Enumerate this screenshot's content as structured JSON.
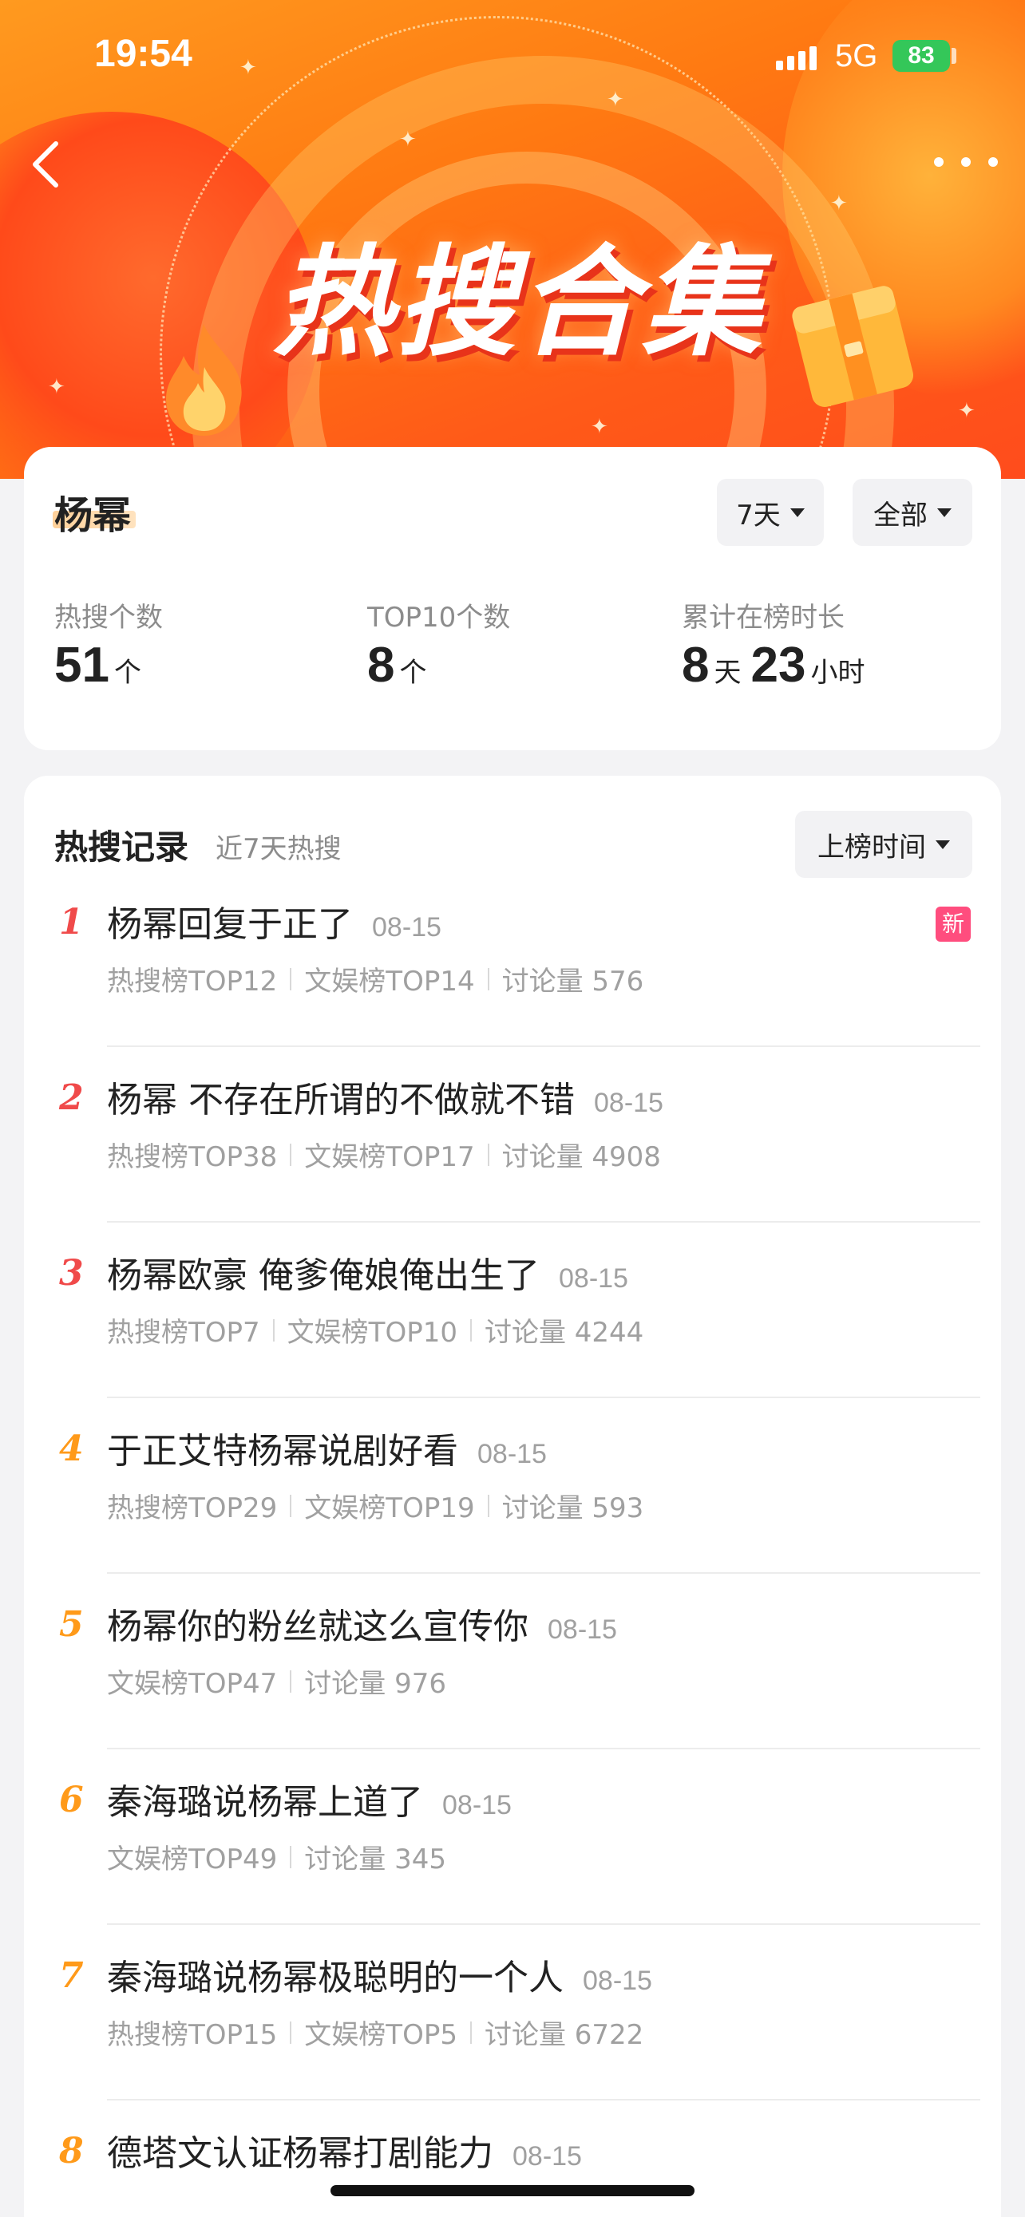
{
  "status": {
    "time": "19:54",
    "network": "5G",
    "battery": "83"
  },
  "header": {
    "title": "热搜合集"
  },
  "person": {
    "name": "杨幂",
    "filters": {
      "period": "7天",
      "scope": "全部"
    }
  },
  "stats": [
    {
      "label": "热搜个数",
      "value": "51",
      "unit": "个"
    },
    {
      "label": "TOP10个数",
      "value": "8",
      "unit": "个"
    },
    {
      "label": "累计在榜时长",
      "value": "8",
      "unit": "天",
      "value2": "23",
      "unit2": "小时"
    }
  ],
  "records_section": {
    "title": "热搜记录",
    "subtitle": "近7天热搜",
    "sort_label": "上榜时间",
    "new_badge": "新",
    "items": [
      {
        "rank": "1",
        "rank_color": "#f04a4a",
        "title": "杨幂回复于正了",
        "date": "08-15",
        "meta": [
          "热搜榜TOP12",
          "文娱榜TOP14",
          "讨论量 576"
        ]
      },
      {
        "rank": "2",
        "rank_color": "#f04a4a",
        "title": "杨幂 不存在所谓的不做就不错",
        "date": "08-15",
        "meta": [
          "热搜榜TOP38",
          "文娱榜TOP17",
          "讨论量 4908"
        ]
      },
      {
        "rank": "3",
        "rank_color": "#f04a4a",
        "title": "杨幂欧豪 俺爹俺娘俺出生了",
        "date": "08-15",
        "meta": [
          "热搜榜TOP7",
          "文娱榜TOP10",
          "讨论量 4244"
        ]
      },
      {
        "rank": "4",
        "rank_color": "#ff9a1a",
        "title": "于正艾特杨幂说剧好看",
        "date": "08-15",
        "meta": [
          "热搜榜TOP29",
          "文娱榜TOP19",
          "讨论量 593"
        ]
      },
      {
        "rank": "5",
        "rank_color": "#ff9a1a",
        "title": "杨幂你的粉丝就这么宣传你",
        "date": "08-15",
        "meta": [
          "文娱榜TOP47",
          "讨论量 976"
        ]
      },
      {
        "rank": "6",
        "rank_color": "#ff9a1a",
        "title": "秦海璐说杨幂上道了",
        "date": "08-15",
        "meta": [
          "文娱榜TOP49",
          "讨论量 345"
        ]
      },
      {
        "rank": "7",
        "rank_color": "#ff9a1a",
        "title": "秦海璐说杨幂极聪明的一个人",
        "date": "08-15",
        "meta": [
          "热搜榜TOP15",
          "文娱榜TOP5",
          "讨论量 6722"
        ]
      },
      {
        "rank": "8",
        "rank_color": "#ff9a1a",
        "title": "德塔文认证杨幂打剧能力",
        "date": "08-15",
        "meta": []
      }
    ]
  },
  "icons": {
    "back": "chevron-left-icon",
    "more": "more-dots-icon",
    "caret": "caret-down-icon",
    "signal": "signal-icon",
    "battery": "battery-icon"
  }
}
